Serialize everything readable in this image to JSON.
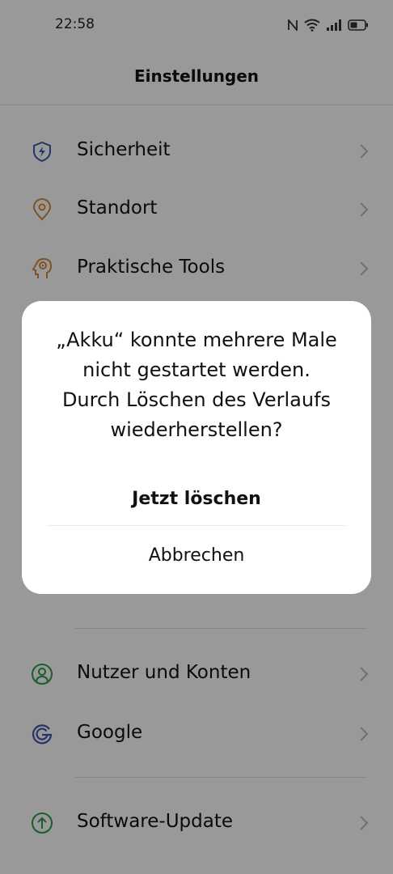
{
  "status_bar": {
    "time": "22:58",
    "icons": [
      "nfc-icon",
      "wifi-icon",
      "signal-icon",
      "battery-icon"
    ]
  },
  "header": {
    "title": "Einstellungen"
  },
  "settings": {
    "items": [
      {
        "label": "Sicherheit",
        "icon": "shield-bolt-icon",
        "color": "#3d5aa8"
      },
      {
        "label": "Standort",
        "icon": "location-pin-icon",
        "color": "#d8893a"
      },
      {
        "label": "Praktische Tools",
        "icon": "tools-head-icon",
        "color": "#d8893a"
      },
      {
        "label": "Nutzer und Konten",
        "icon": "user-icon",
        "color": "#2f9a4e"
      },
      {
        "label": "Google",
        "icon": "google-icon",
        "color": "#3d5aa8"
      },
      {
        "label": "Software-Update",
        "icon": "update-arrow-icon",
        "color": "#2f9a4e"
      }
    ]
  },
  "dialog": {
    "message": "„Akku“ konnte mehrere Male nicht gestartet werden. Durch Löschen des Verlaufs wiederherstellen?",
    "confirm_label": "Jetzt löschen",
    "cancel_label": "Abbrechen"
  },
  "colors": {
    "overlay": "rgba(0,0,0,0.40)",
    "dialog_background": "#ffffff",
    "text": "#111111"
  }
}
